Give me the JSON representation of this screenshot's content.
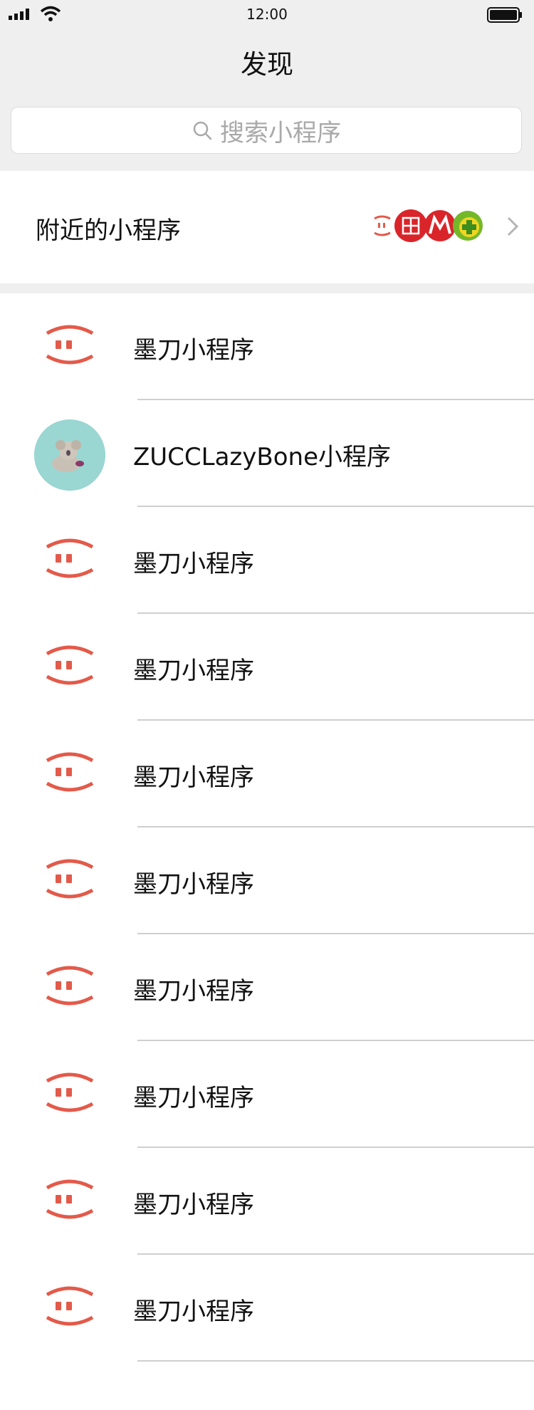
{
  "status_bar": {
    "time": "12:00"
  },
  "header": {
    "title": "发现",
    "search_placeholder": "搜索小程序"
  },
  "nearby": {
    "label": "附近的小程序",
    "icon_names": [
      "moda-icon",
      "red-logo-icon",
      "metro-logo-icon",
      "green-plus-icon"
    ]
  },
  "mini_programs": [
    {
      "label": "墨刀小程序",
      "icon": "moda-icon"
    },
    {
      "label": "ZUCCLazyBone小程序",
      "icon": "koala-avatar"
    },
    {
      "label": "墨刀小程序",
      "icon": "moda-icon"
    },
    {
      "label": "墨刀小程序",
      "icon": "moda-icon"
    },
    {
      "label": "墨刀小程序",
      "icon": "moda-icon"
    },
    {
      "label": "墨刀小程序",
      "icon": "moda-icon"
    },
    {
      "label": "墨刀小程序",
      "icon": "moda-icon"
    },
    {
      "label": "墨刀小程序",
      "icon": "moda-icon"
    },
    {
      "label": "墨刀小程序",
      "icon": "moda-icon"
    },
    {
      "label": "墨刀小程序",
      "icon": "moda-icon"
    }
  ],
  "colors": {
    "accent_red": "#e35a4a",
    "background_gray": "#efefef",
    "avatar_teal": "#9ad6d2"
  }
}
